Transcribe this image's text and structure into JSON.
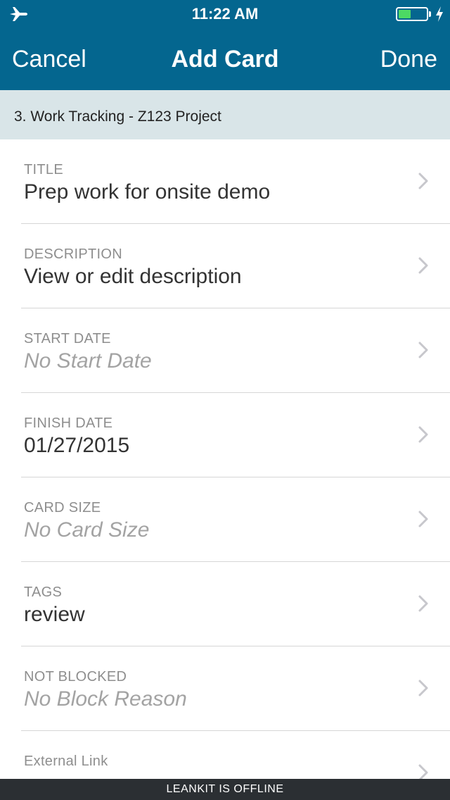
{
  "status_bar": {
    "time": "11:22 AM",
    "airplane_icon": "airplane-icon",
    "battery_level": 0.4,
    "charging_icon": "bolt-icon"
  },
  "nav": {
    "cancel_label": "Cancel",
    "title": "Add Card",
    "done_label": "Done"
  },
  "board": {
    "path": "3. Work Tracking - Z123 Project"
  },
  "fields": [
    {
      "label": "TITLE",
      "value": "Prep work for onsite demo",
      "placeholder": false
    },
    {
      "label": "DESCRIPTION",
      "value": "View or edit description",
      "placeholder": false
    },
    {
      "label": "START DATE",
      "value": "No Start Date",
      "placeholder": true
    },
    {
      "label": "FINISH DATE",
      "value": "01/27/2015",
      "placeholder": false
    },
    {
      "label": "CARD SIZE",
      "value": "No Card Size",
      "placeholder": true
    },
    {
      "label": "TAGS",
      "value": "review",
      "placeholder": false
    },
    {
      "label": "NOT BLOCKED",
      "value": "No Block Reason",
      "placeholder": true
    },
    {
      "label": "External Link",
      "value": "",
      "placeholder": true
    }
  ],
  "offline_banner": "LEANKIT IS OFFLINE",
  "colors": {
    "header": "#04668f",
    "board_bar": "#d9e5e8",
    "offline_bar": "#2b2f33",
    "battery": "#4cd964"
  }
}
